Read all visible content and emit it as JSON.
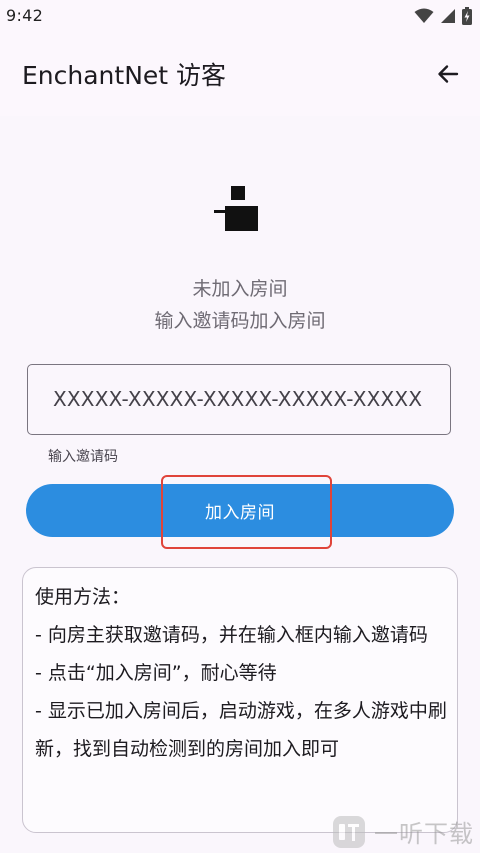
{
  "status_bar": {
    "time": "9:42"
  },
  "app_bar": {
    "title": "EnchantNet 访客",
    "back_icon": "arrow-left-icon"
  },
  "empty_state": {
    "icon": "room-icon",
    "line1": "未加入房间",
    "line2": "输入邀请码加入房间"
  },
  "invite": {
    "value": "XXXXX-XXXXX-XXXXX-XXXXX-XXXXX",
    "helper": "输入邀请码"
  },
  "join_button": {
    "label": "加入房间",
    "color": "#2c8de0"
  },
  "usage": {
    "title": "使用方法：",
    "step1": "- 向房主获取邀请码，并在输入框内输入邀请码",
    "step2": "- 点击“加入房间”，耐心等待",
    "step3": "- 显示已加入房间后，启动游戏，在多人游戏中刷新，找到自动检测到的房间加入即可"
  },
  "watermark": {
    "text": "一听下载"
  },
  "colors": {
    "highlight": "#e0443a",
    "background": "#fcf7fd"
  }
}
